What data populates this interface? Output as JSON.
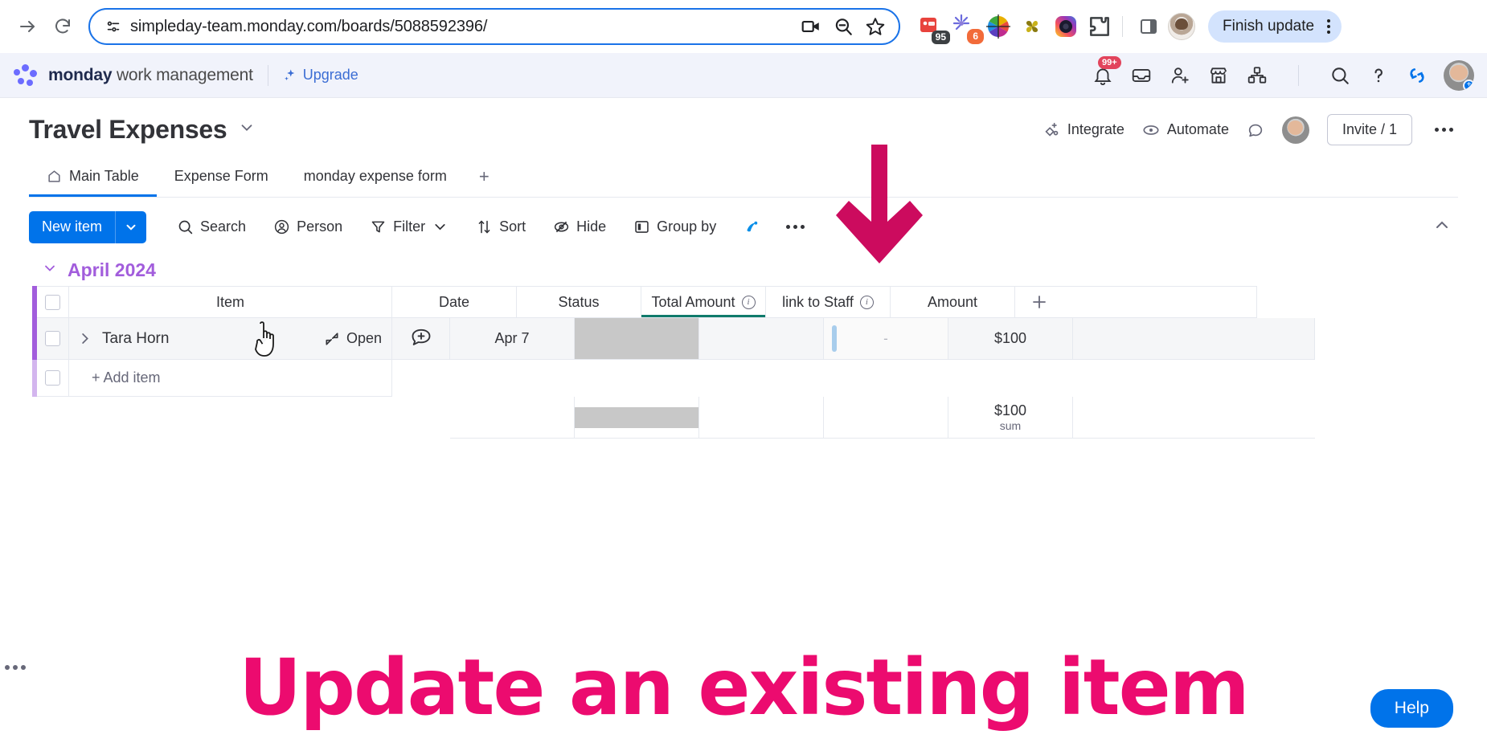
{
  "browser": {
    "url": "simpleday-team.monday.com/boards/5088592396/",
    "forward_icon": "forward-arrow-icon",
    "reload_icon": "reload-icon",
    "site_info_icon": "site-settings-icon",
    "video_icon": "video-camera-icon",
    "zoom_icon": "zoom-out-icon",
    "bookmark_icon": "star-icon",
    "finish_update_label": "Finish update",
    "extensions": [
      {
        "name": "pocket-extension",
        "badge": "95"
      },
      {
        "name": "grammarly-extension",
        "badge": "6"
      },
      {
        "name": "color-wheel-extension",
        "badge": ""
      },
      {
        "name": "pinwheel-extension",
        "badge": ""
      },
      {
        "name": "instagram-extension",
        "badge": ""
      },
      {
        "name": "puzzle-extensions-icon",
        "badge": ""
      }
    ],
    "sidepanel_icon": "side-panel-icon"
  },
  "monday_header": {
    "brand_bold": "monday",
    "brand_rest": " work management",
    "upgrade_label": "Upgrade",
    "notifications_badge": "99+",
    "icons": [
      "bell-icon",
      "inbox-icon",
      "invite-person-icon",
      "marketplace-icon",
      "apps-icon",
      "search-icon",
      "help-icon"
    ]
  },
  "board": {
    "title": "Travel Expenses",
    "integrate_label": "Integrate",
    "automate_label": "Automate",
    "invite_label": "Invite / 1",
    "tabs": [
      {
        "label": "Main Table",
        "icon": "home-icon",
        "active": true
      },
      {
        "label": "Expense Form",
        "icon": "",
        "active": false
      },
      {
        "label": "monday expense form",
        "icon": "",
        "active": false
      }
    ],
    "tab_add_label": "+"
  },
  "toolbar": {
    "new_item_label": "New item",
    "buttons": [
      {
        "label": "Search",
        "icon": "search-icon"
      },
      {
        "label": "Person",
        "icon": "person-icon"
      },
      {
        "label": "Filter",
        "icon": "filter-icon"
      },
      {
        "label": "Sort",
        "icon": "sort-icon"
      },
      {
        "label": "Hide",
        "icon": "hide-eye-icon"
      },
      {
        "label": "Group by",
        "icon": "group-by-icon"
      }
    ]
  },
  "table": {
    "group_name": "April 2024",
    "columns": [
      {
        "label": "Item",
        "info": false
      },
      {
        "label": "Date",
        "info": false
      },
      {
        "label": "Status",
        "info": false
      },
      {
        "label": "Total Amount",
        "info": true
      },
      {
        "label": "link to Staff",
        "info": true
      },
      {
        "label": "Amount",
        "info": false
      }
    ],
    "add_column_label": "+",
    "rows": [
      {
        "item": "Tara Horn",
        "open_label": "Open",
        "date": "Apr 7",
        "status": "",
        "total_amount": "",
        "link_to_staff": "-",
        "amount": "$100"
      }
    ],
    "add_item_label": "+ Add item",
    "summary": {
      "amount_value": "$100",
      "amount_label": "sum"
    }
  },
  "overlay": {
    "headline": "Update an existing item",
    "headline_color": "#ec0b6f",
    "arrow_color": "#cc0b5e",
    "help_label": "Help"
  }
}
